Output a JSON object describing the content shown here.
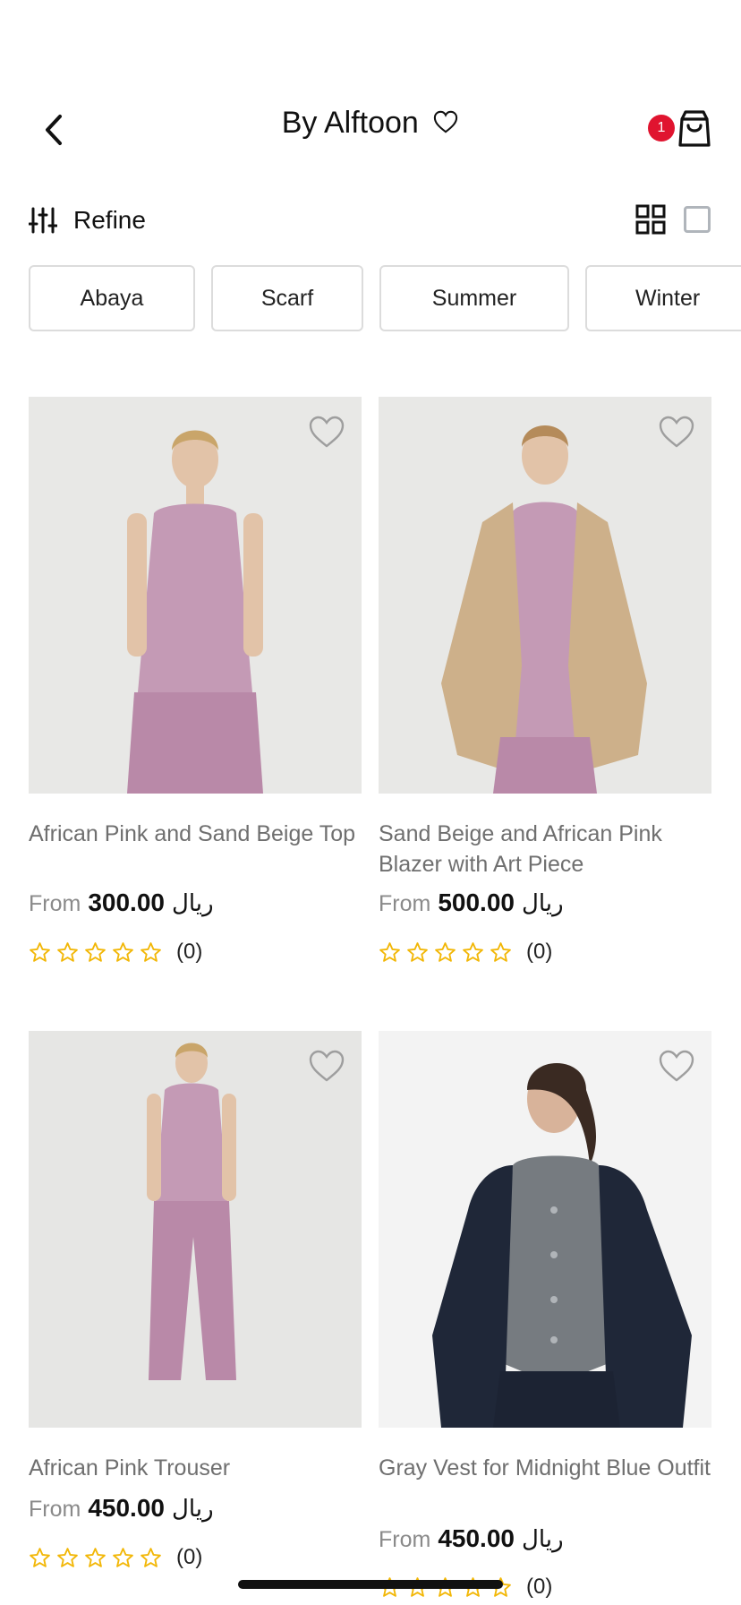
{
  "header": {
    "title": "By Alftoon",
    "cart_badge": "1"
  },
  "toolbar": {
    "refine_label": "Refine"
  },
  "chips": [
    "Abaya",
    "Scarf",
    "Summer",
    "Winter"
  ],
  "colors": {
    "badge": "#e0142f",
    "star": "#f2b707",
    "name_text": "#6f6f6f"
  },
  "products": [
    {
      "name": "African Pink and Sand Beige Top",
      "from": "From",
      "price": "300.00",
      "currency": "ريال",
      "rating_count": "(0)"
    },
    {
      "name": "Sand Beige and African Pink Blazer with Art Piece",
      "from": "From",
      "price": "500.00",
      "currency": "ريال",
      "rating_count": "(0)"
    },
    {
      "name": "African Pink Trouser",
      "from": "From",
      "price": "450.00",
      "currency": "ريال",
      "rating_count": "(0)"
    },
    {
      "name": "Gray Vest for Midnight Blue Outfit",
      "from": "From",
      "price": "450.00",
      "currency": "ريال",
      "rating_count": "(0)"
    }
  ]
}
